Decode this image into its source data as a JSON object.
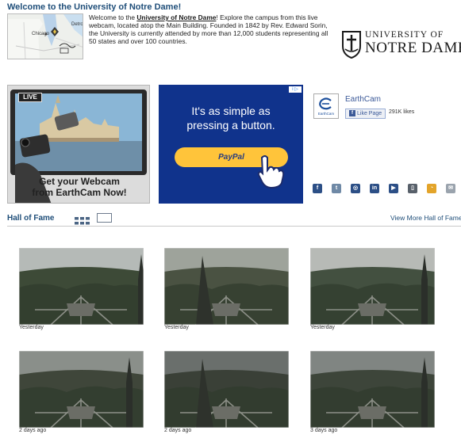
{
  "header": {
    "title": "Welcome to the University of Notre Dame!",
    "intro_before": "Welcome to the ",
    "intro_link": "University of Notre Dame",
    "intro_after": "! Explore the campus from this live webcam, located atop the Main Building. Founded in 1842 by Rev. Edward Sorin, the University is currently attended by more than 12,000 students representing all 50 states and over 100 countries.",
    "logo_line1": "UNIVERSITY OF",
    "logo_line2": "NOTRE DAME"
  },
  "map": {
    "label_chicago": "Chicago",
    "label_detroit": "Detro"
  },
  "ads": {
    "webcam_ad": {
      "live_label": "LIVE",
      "line1": "Get your Webcam",
      "line2": "from EarthCam Now!"
    },
    "paypal_ad": {
      "choice_label": "i ▷",
      "line1": "It's as simple as",
      "line2": "pressing a button.",
      "button_label": "PayPal"
    }
  },
  "earthcam_box": {
    "name": "EarthCam",
    "logo_text": "EarthCam",
    "like_label": "Like Page",
    "likes": "291K likes"
  },
  "social": {
    "icons": [
      "facebook-icon",
      "twitter-icon",
      "instagram-icon",
      "linkedin-icon",
      "youtube-icon",
      "mobile-app-icon",
      "rss-icon",
      "email-icon"
    ]
  },
  "hall_of_fame": {
    "title": "Hall of Fame",
    "view_more": "View More Hall of Fame",
    "items": [
      {
        "caption": "Yesterday"
      },
      {
        "caption": "Yesterday"
      },
      {
        "caption": "Yesterday"
      },
      {
        "caption": "2 days ago"
      },
      {
        "caption": "2 days ago"
      },
      {
        "caption": "3 days ago"
      }
    ]
  },
  "colors": {
    "heading": "#1f4e79",
    "paypal_blue": "#10338c",
    "paypal_yellow": "#ffc43a",
    "nd_navy": "#0c2340"
  }
}
